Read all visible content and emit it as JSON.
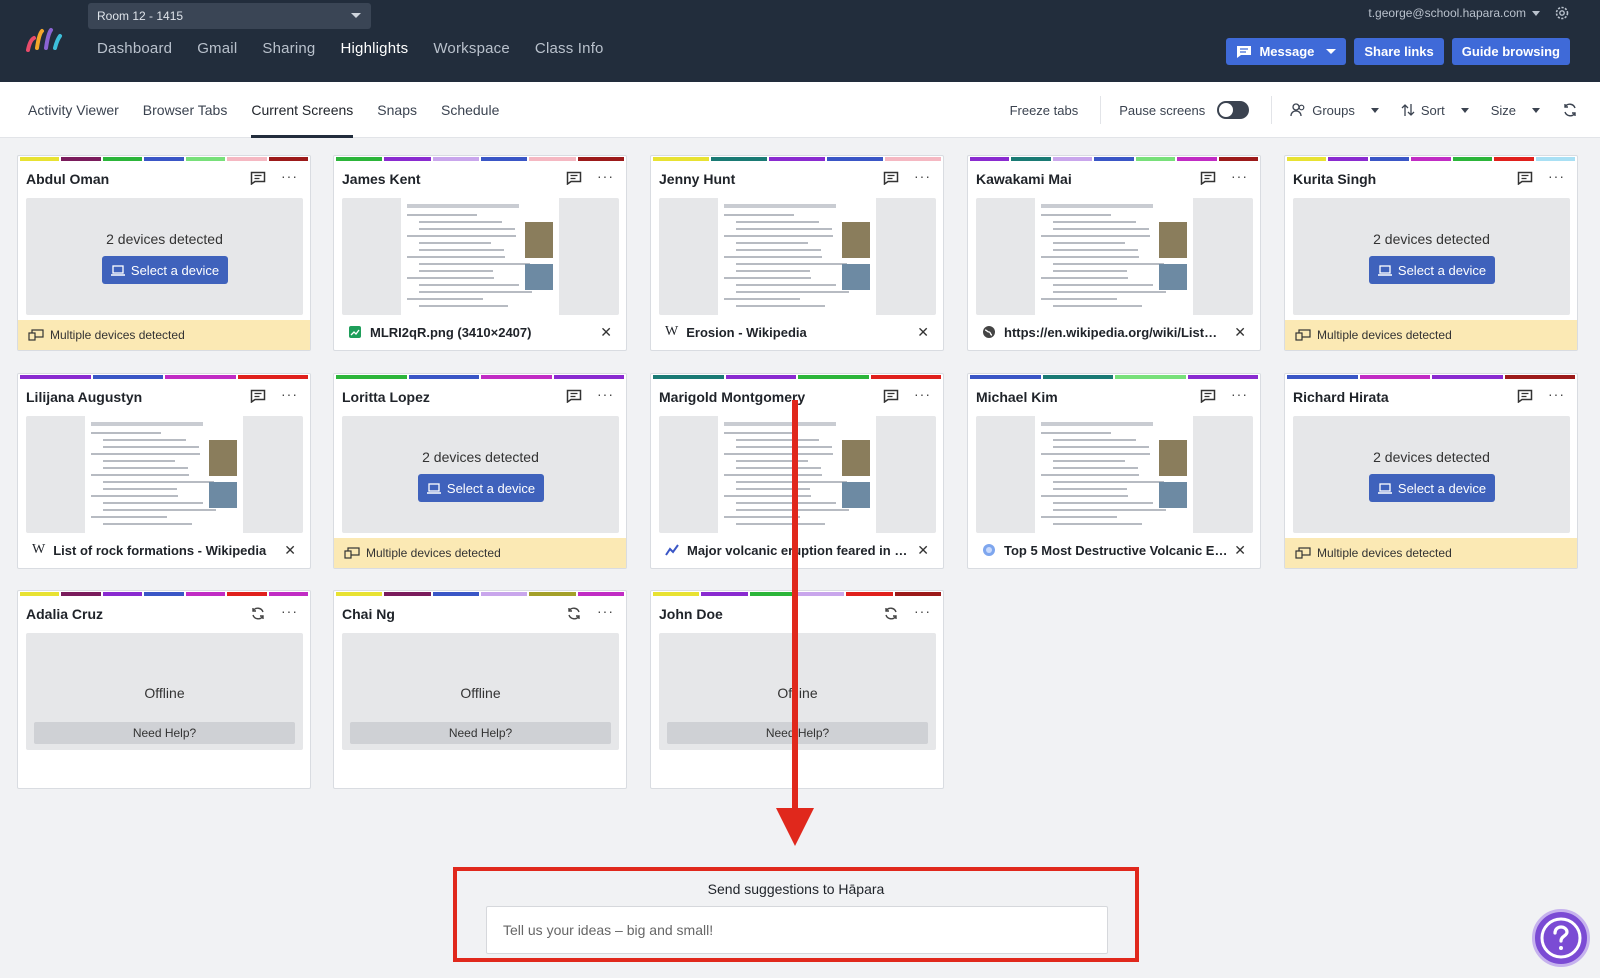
{
  "room": "Room 12 - 1415",
  "nav": [
    "Dashboard",
    "Gmail",
    "Sharing",
    "Highlights",
    "Workspace",
    "Class Info"
  ],
  "user_email": "t.george@school.hapara.com",
  "top_buttons": {
    "message": "Message",
    "share_links": "Share links",
    "guide_browsing": "Guide browsing"
  },
  "subnav": [
    "Activity Viewer",
    "Browser Tabs",
    "Current Screens",
    "Snaps",
    "Schedule"
  ],
  "tools": {
    "freeze": "Freeze tabs",
    "pause": "Pause screens",
    "groups": "Groups",
    "sort": "Sort",
    "size": "Size"
  },
  "labels": {
    "devices_detected": "2 devices detected",
    "select_device": "Select a device",
    "multiple": "Multiple devices detected",
    "offline": "Offline",
    "need_help": "Need Help?"
  },
  "students": [
    {
      "name": "Abdul Oman",
      "state": "multi",
      "stripes": [
        "#e8e232",
        "#7a1c5c",
        "#2cb53a",
        "#3a56c6",
        "#78e07a",
        "#f5b8c2",
        "#9c1a1a"
      ]
    },
    {
      "name": "James Kent",
      "state": "tab",
      "tab": "MLRI2qR.png (3410×2407)",
      "icon": "image-file-icon",
      "stripes": [
        "#2cb53a",
        "#8a2bd0",
        "#c9a6ec",
        "#3a56c6",
        "#f5b8c2",
        "#9c1a1a"
      ]
    },
    {
      "name": "Jenny Hunt",
      "state": "tab",
      "tab": "Erosion - Wikipedia",
      "icon": "wikipedia-icon",
      "stripes": [
        "#e8e232",
        "#1a7a74",
        "#8a2bd0",
        "#3a56c6",
        "#f5b8c2"
      ]
    },
    {
      "name": "Kawakami Mai",
      "state": "tab",
      "tab": "https://en.wikipedia.org/wiki/List…",
      "icon": "globe-icon",
      "stripes": [
        "#8a2bd0",
        "#1a7a74",
        "#c9a6ec",
        "#3a56c6",
        "#78e07a",
        "#c12cc4",
        "#9c1a1a"
      ]
    },
    {
      "name": "Kurita Singh",
      "state": "multi",
      "stripes": [
        "#e8e232",
        "#8a2bd0",
        "#3a56c6",
        "#c12cc4",
        "#2cb53a",
        "#e0201c",
        "#a9e0f4"
      ]
    },
    {
      "name": "Lilijana Augustyn",
      "state": "tab",
      "tab": "List of rock formations - Wikipedia",
      "icon": "wikipedia-icon",
      "stripes": [
        "#8a2bd0",
        "#3a56c6",
        "#c12cc4",
        "#e0201c"
      ]
    },
    {
      "name": "Loritta Lopez",
      "state": "multi",
      "stripes": [
        "#2cb53a",
        "#3a56c6",
        "#c12cc4",
        "#8a2bd0"
      ]
    },
    {
      "name": "Marigold Montgomery",
      "state": "tab",
      "tab": "Major volcanic eruption feared in …",
      "icon": "news-icon",
      "stripes": [
        "#1a7a74",
        "#8a2bd0",
        "#2cb53a",
        "#e0201c"
      ]
    },
    {
      "name": "Michael Kim",
      "state": "tab",
      "tab": "Top 5 Most Destructive Volcanic E…",
      "icon": "site-icon",
      "stripes": [
        "#3a56c6",
        "#1a7a74",
        "#78e07a",
        "#8a2bd0"
      ]
    },
    {
      "name": "Richard Hirata",
      "state": "multi",
      "stripes": [
        "#3a56c6",
        "#c12cc4",
        "#8a2bd0",
        "#9c1a1a"
      ]
    },
    {
      "name": "Adalia Cruz",
      "state": "offline",
      "stripes": [
        "#e8e232",
        "#7a1c5c",
        "#8a2bd0",
        "#3a56c6",
        "#c12cc4",
        "#e0201c",
        "#c12cc4"
      ]
    },
    {
      "name": "Chai Ng",
      "state": "offline",
      "stripes": [
        "#e8e232",
        "#7a1c5c",
        "#3a56c6",
        "#c9a6ec",
        "#a4a02a",
        "#c12cc4"
      ]
    },
    {
      "name": "John Doe",
      "state": "offline",
      "stripes": [
        "#e8e232",
        "#8a2bd0",
        "#2cb53a",
        "#c9a6ec",
        "#e0201c",
        "#9c1a1a"
      ]
    }
  ],
  "suggestions": {
    "title": "Send suggestions to Hāpara",
    "placeholder": "Tell us your ideas – big and small!"
  },
  "colors": {
    "navbar": "#222d3c",
    "accent": "#3f6ad8",
    "highlight": "#e0281c"
  }
}
